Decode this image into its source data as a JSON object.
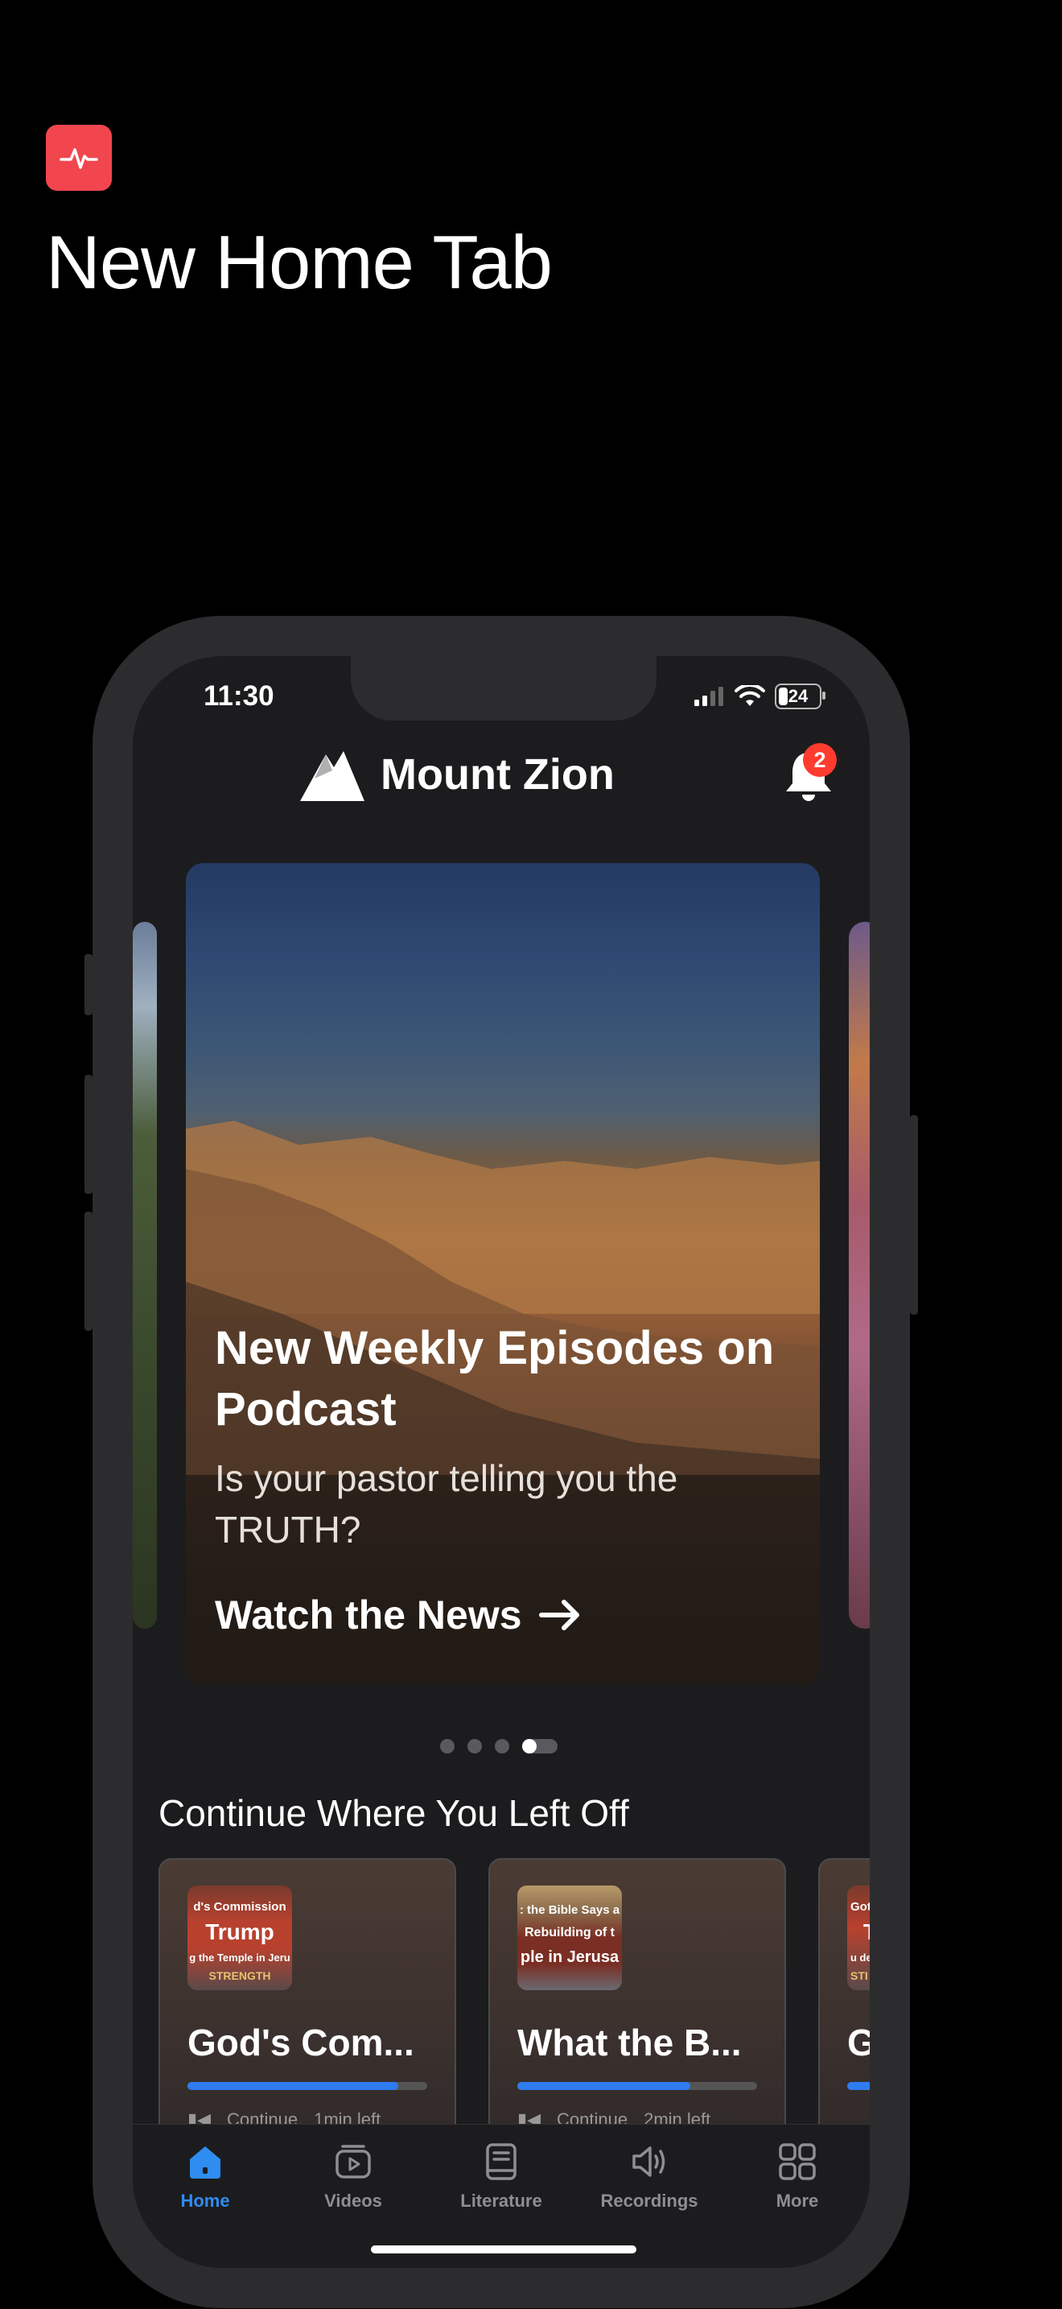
{
  "promo": {
    "icon": "activity-pulse-icon",
    "title": "New Home Tab"
  },
  "status_bar": {
    "time": "11:30",
    "battery": "24"
  },
  "header": {
    "brand_name": "Mount Zion",
    "logo_icon": "mountain-logo-icon",
    "notification_count": "2"
  },
  "hero": {
    "title": "New Weekly Episodes on Podcast",
    "subtitle": "Is your pastor telling you the TRUTH?",
    "cta_label": "Watch the News",
    "active_slide": 4,
    "total_slides": 4
  },
  "continue_section": {
    "title": "Continue Where You Left Off",
    "cards": [
      {
        "thumb_lines": [
          "d's Commission",
          "Trump",
          "g the Temple in Jeru",
          "STRENGTH"
        ],
        "title": "God's Com...",
        "progress": 0.88,
        "action": "Continue",
        "remaining": "1min left"
      },
      {
        "thumb_lines": [
          ": the Bible Says a",
          "Rebuilding of t",
          "ple in Jerusa"
        ],
        "title": "What the B...",
        "progress": 0.72,
        "action": "Continue",
        "remaining": "2min left"
      },
      {
        "thumb_lines": [
          "Gotte",
          "Tr",
          "u des",
          "STI"
        ],
        "title": "G",
        "progress": 0.5,
        "action": "",
        "remaining": ""
      }
    ]
  },
  "tabbar": {
    "tabs": [
      {
        "label": "Home",
        "icon": "home-icon",
        "active": true
      },
      {
        "label": "Videos",
        "icon": "video-icon",
        "active": false
      },
      {
        "label": "Literature",
        "icon": "book-icon",
        "active": false
      },
      {
        "label": "Recordings",
        "icon": "speaker-icon",
        "active": false
      },
      {
        "label": "More",
        "icon": "grid-icon",
        "active": false
      }
    ]
  },
  "colors": {
    "accent": "#2f8cf0",
    "badge": "#ff3b30",
    "promo_icon_bg": "#f2464f",
    "progress": "#2f7bf0"
  }
}
